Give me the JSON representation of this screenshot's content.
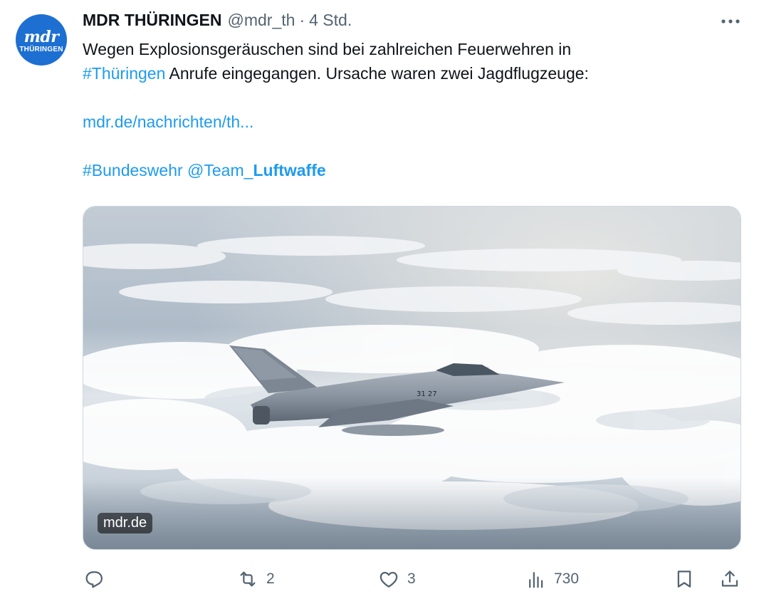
{
  "tweet": {
    "avatar": {
      "logo_top": "mdr",
      "logo_bottom": "THÜRINGEN"
    },
    "display_name": "MDR THÜRINGEN",
    "handle": "@mdr_th",
    "separator": "·",
    "time": "4 Std.",
    "text": {
      "line1": "Wegen Explosionsgeräuschen sind bei zahlreichen Feuerwehren in",
      "hashtag_thueringen": "#Thüringen",
      "line2_rest": " Anrufe eingegangen. Ursache waren zwei Jagdflugzeuge:",
      "url": "mdr.de/nachrichten/th...",
      "hashtag_bundeswehr": "#Bundeswehr",
      "mention_prefix": "@Team_",
      "mention_highlight": "Luftwaffe"
    },
    "media": {
      "source_label": "mdr.de",
      "aircraft_marking": "31 27"
    },
    "actions": {
      "replies": "",
      "retweets": "2",
      "likes": "3",
      "views": "730"
    }
  },
  "icons": {
    "more": "more-horizontal-icon",
    "reply": "reply-icon",
    "retweet": "retweet-icon",
    "like": "heart-icon",
    "views": "analytics-icon",
    "bookmark": "bookmark-icon",
    "share": "share-icon"
  },
  "colors": {
    "link": "#1d9bf0",
    "text": "#0f1419",
    "secondary": "#536471",
    "avatar_bg": "#1d6fd1"
  }
}
